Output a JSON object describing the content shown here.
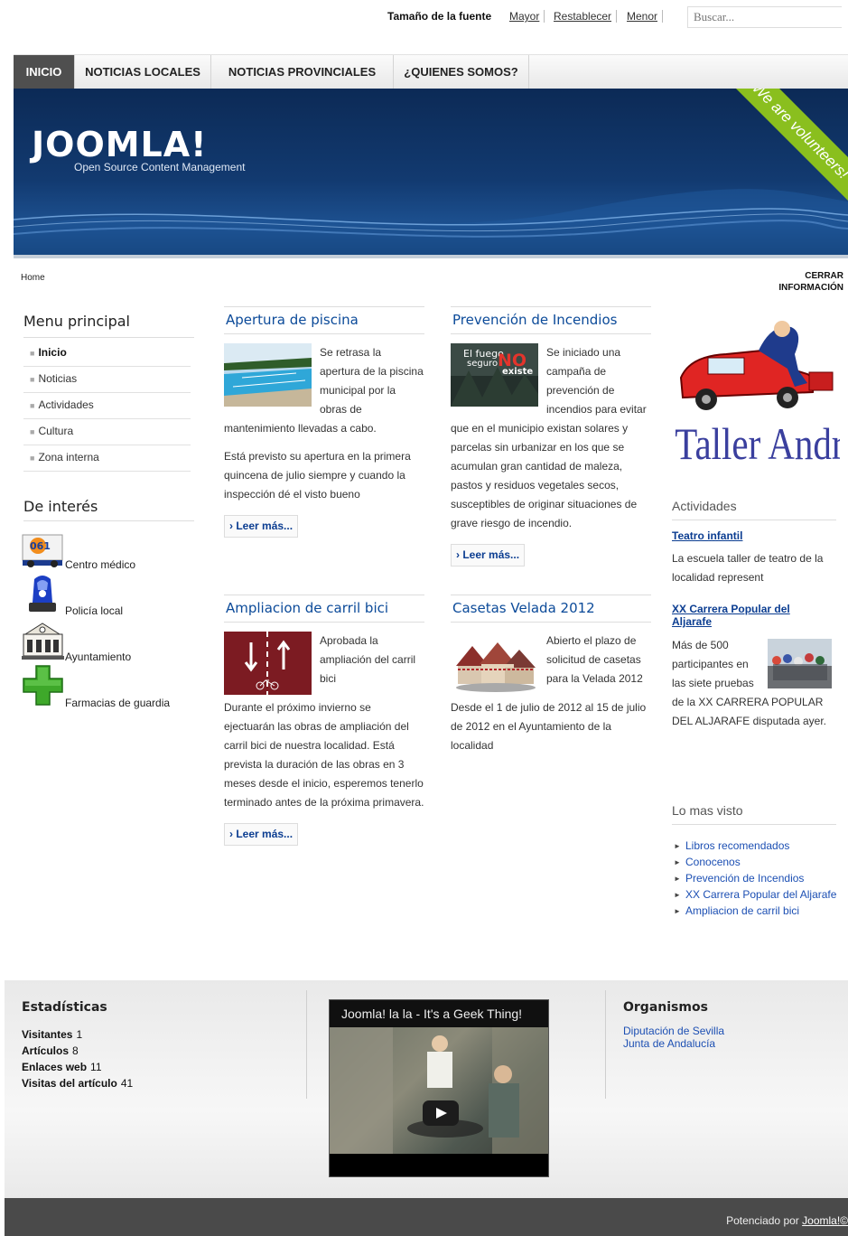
{
  "topbar": {
    "font_size_label": "Tamaño de la fuente",
    "links": [
      "Mayor",
      "Restablecer",
      "Menor"
    ],
    "search_placeholder": "Buscar..."
  },
  "nav": {
    "items": [
      "INICIO",
      "NOTICIAS LOCALES",
      "NOTICIAS PROVINCIALES",
      "¿QUIENES SOMOS?"
    ],
    "active": "INICIO"
  },
  "header": {
    "logo": "JOOMLA!",
    "tagline": "Open Source Content Management",
    "ribbon": "We are volunteers!",
    "colors": {
      "banner": "#123a70",
      "ribbon": "#8abf1e"
    }
  },
  "breadcrumb": "Home",
  "close_info": {
    "line1": "CERRAR",
    "line2": "INFORMACIÓN"
  },
  "menu_principal": {
    "title": "Menu principal",
    "items": [
      "Inicio",
      "Noticias",
      "Actividades",
      "Cultura",
      "Zona interna"
    ]
  },
  "de_interes": {
    "title": "De interés",
    "items": [
      {
        "label": "Centro médico",
        "icon": "ambulance-icon"
      },
      {
        "label": "Policía local",
        "icon": "police-light-icon"
      },
      {
        "label": "Ayuntamiento",
        "icon": "town-hall-icon"
      },
      {
        "label": "Farmacias de guardia",
        "icon": "pharmacy-cross-icon"
      }
    ]
  },
  "articles": [
    {
      "title": "Apertura de piscina",
      "intro": "Se retrasa la apertura de la piscina municipal por la obras de mantenimiento llevadas a cabo.",
      "body": "Está previsto su apertura en la primera quincena de julio siempre y cuando la inspección dé el visto bueno",
      "readmore": "Leer más..."
    },
    {
      "title": "Prevención de Incendios",
      "image_text": [
        "El fuego",
        "seguro",
        "NO",
        "existe"
      ],
      "intro": "Se iniciado una campaña de prevención de incendios para evitar que en el municipio existan solares y parcelas sin urbanizar en los que se acumulan gran cantidad de maleza, pastos y residuos vegetales secos, susceptibles de originar situaciones de grave riesgo de incendio.",
      "readmore": "Leer más..."
    },
    {
      "title": "Ampliacion de carril bici",
      "intro": "Aprobada la ampliación del carril bici",
      "body": "Durante el próximo invierno se ejectuarán las obras de ampliación del carril bici de nuestra localidad. Está prevista la duración de las obras en 3 meses desde el inicio, esperemos tenerlo terminado antes de la próxima primavera.",
      "readmore": "Leer más..."
    },
    {
      "title": "Casetas Velada 2012",
      "intro": "Abierto el plazo de solicitud de casetas para la Velada 2012",
      "body": "Desde el 1 de julio de 2012 al 15 de julio de 2012 en el Ayuntamiento de la localidad"
    }
  ],
  "ad": {
    "text": "Taller Andrés"
  },
  "actividades": {
    "title": "Actividades",
    "items": [
      {
        "title": "Teatro infantil",
        "text": "La escuela taller de teatro de la localidad represent"
      },
      {
        "title": "XX Carrera Popular del Aljarafe",
        "text": "Más de 500 participantes en las siete pruebas de la XX CARRERA POPULAR DEL ALJARAFE disputada ayer."
      }
    ]
  },
  "lo_mas_visto": {
    "title": "Lo mas visto",
    "items": [
      "Libros recomendados",
      "Conocenos",
      "Prevención de Incendios",
      "XX Carrera Popular del Aljarafe",
      "Ampliacion de carril bici"
    ]
  },
  "footer": {
    "stats_title": "Estadísticas",
    "stats": [
      {
        "label": "Visitantes",
        "value": "1"
      },
      {
        "label": "Artículos",
        "value": "8"
      },
      {
        "label": "Enlaces web",
        "value": "11"
      },
      {
        "label": "Visitas del artículo",
        "value": "41"
      }
    ],
    "video_title": "Joomla! la la - It's a Geek Thing!",
    "org_title": "Organismos",
    "org_links": [
      "Diputación de Sevilla",
      "Junta de Andalucía"
    ],
    "powered_prefix": "Potenciado por",
    "powered_link": "Joomla!©"
  }
}
